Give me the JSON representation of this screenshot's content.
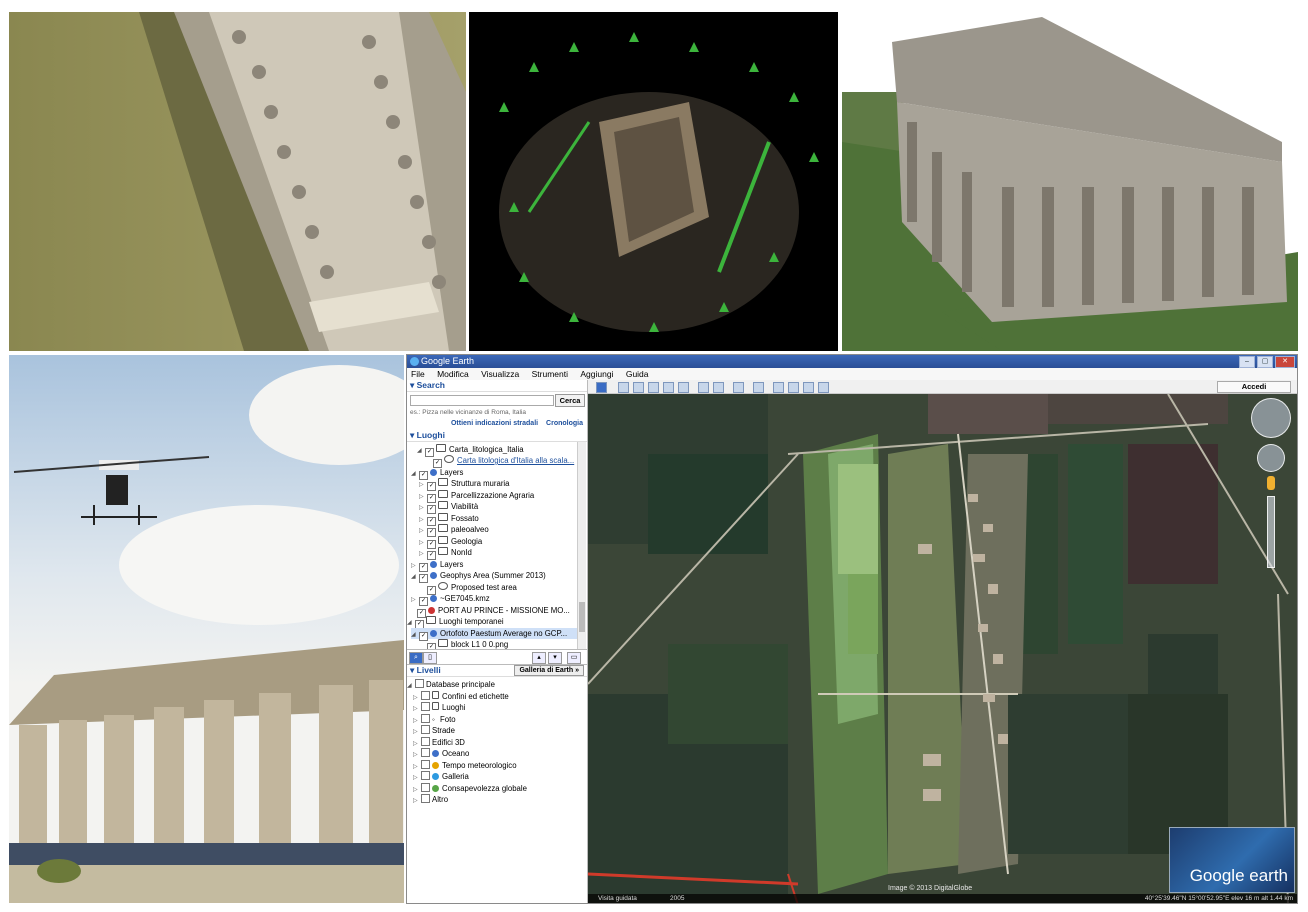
{
  "window": {
    "title": "Google Earth"
  },
  "menu": [
    "File",
    "Modifica",
    "Visualizza",
    "Strumenti",
    "Aggiungi",
    "Guida"
  ],
  "search": {
    "header": "Search",
    "button": "Cerca",
    "hint": "es.: Pizza nelle vicinanze di Roma, Italia",
    "link_directions": "Ottieni indicazioni stradali",
    "link_history": "Cronologia"
  },
  "places": {
    "header": "Luoghi",
    "items": [
      "Carta_litologica_Italia",
      "Carta litologica d'Italia alla scala...",
      "Layers",
      "Struttura muraria",
      "Parcellizzazione Agraria",
      "Viabilità",
      "Fossato",
      "paleoalveo",
      "Geologia",
      "NonId",
      "Layers",
      "Geophys Area (Summer 2013)",
      "Proposed test area",
      "~GE7045.kmz",
      "PORT AU PRINCE - MISSIONE MO...",
      "Luoghi temporanei",
      "Ortofoto Paestum Average no GCP...",
      "block L1 0 0.png"
    ]
  },
  "layers": {
    "header": "Livelli",
    "gallery_button": "Galleria di Earth",
    "items": [
      "Database principale",
      "Confini ed etichette",
      "Luoghi",
      "Foto",
      "Strade",
      "Edifici 3D",
      "Oceano",
      "Tempo meteorologico",
      "Galleria",
      "Consapevolezza globale",
      "Altro"
    ]
  },
  "toolbar": {
    "signin": "Accedi"
  },
  "map": {
    "copyright": "Image © 2013 DigitalGlobe",
    "status_left": "Visita guidata",
    "status_year": "2005",
    "status_coords": "40°25'39.46\"N  15°00'52.95\"E  elev  16 m    alt  1.44 km",
    "logo": "Google earth"
  },
  "colors": {
    "titlebar": "#2f58a6",
    "link": "#1d4f9c"
  }
}
